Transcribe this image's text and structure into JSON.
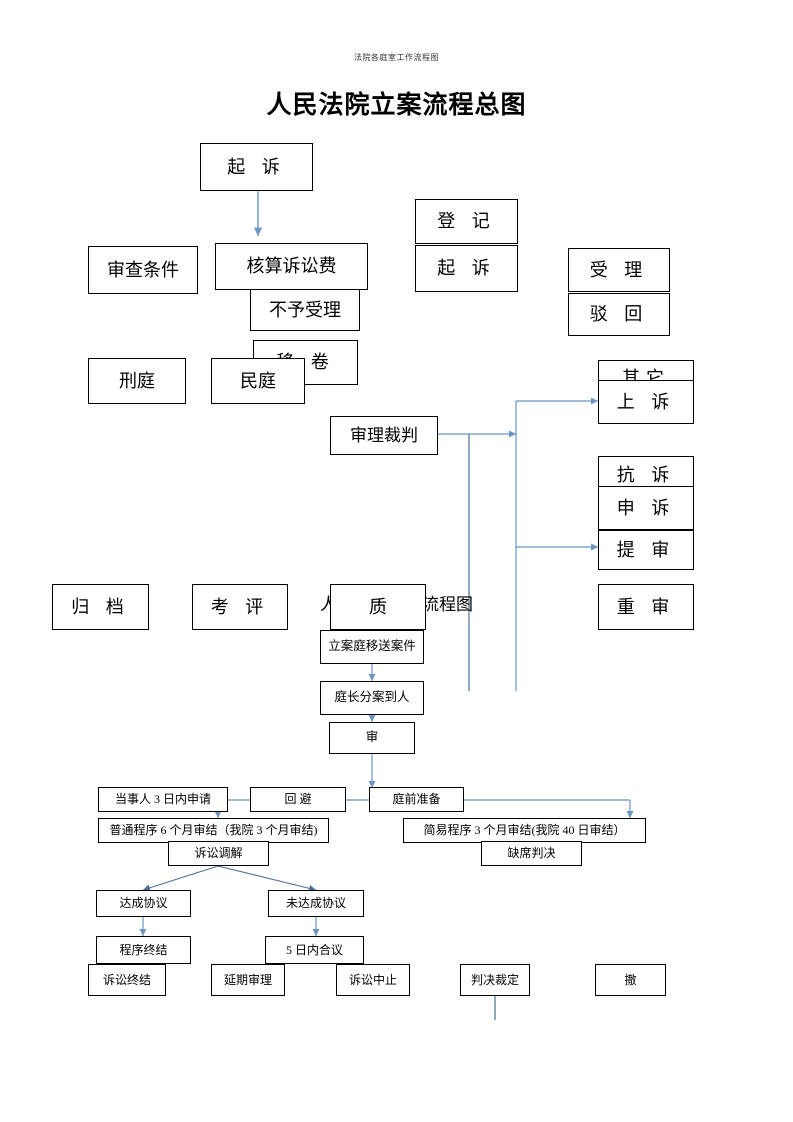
{
  "page": {
    "header_note": "法院各庭室工作流程图",
    "title_main": "人民法院立案流程总图",
    "title_sub": "人民法院审判流程图",
    "accent_arrow_color": "#6b96c4",
    "accent_line_color": "#3f6f96",
    "border_color": "#000000",
    "background": "#ffffff"
  },
  "filing_chart": {
    "name": "人民法院立案流程总图",
    "nodes": [
      {
        "id": "qisu",
        "label": "起  诉"
      },
      {
        "id": "shencha",
        "label": "审查条件"
      },
      {
        "id": "hesuan",
        "label": "核算诉讼费"
      },
      {
        "id": "buyushouli",
        "label": "不予受理"
      },
      {
        "id": "dengji",
        "label": "登  记"
      },
      {
        "id": "qisu2",
        "label": "起  诉"
      },
      {
        "id": "shouli",
        "label": "受  理"
      },
      {
        "id": "bohui",
        "label": "驳  回"
      },
      {
        "id": "xingting",
        "label": "刑庭"
      },
      {
        "id": "minting",
        "label": "民庭"
      },
      {
        "id": "yijuan",
        "label": "移  卷"
      },
      {
        "id": "shenlicaipan",
        "label": "审理裁判"
      },
      {
        "id": "shangsu_top",
        "label": "其它"
      },
      {
        "id": "shangsu",
        "label": "上  诉"
      },
      {
        "id": "kangsu",
        "label": "抗  诉"
      },
      {
        "id": "shensu",
        "label": "申  诉"
      },
      {
        "id": "tishen",
        "label": "提  审"
      },
      {
        "id": "chongshen",
        "label": "重  审"
      },
      {
        "id": "guidang",
        "label": "归  档"
      },
      {
        "id": "kaoping",
        "label": "考  评"
      },
      {
        "id": "zhi",
        "label": "质"
      }
    ]
  },
  "trial_chart": {
    "name": "人民法院审判流程图",
    "nodes": [
      {
        "id": "yisong",
        "label": "立案庭移送案件"
      },
      {
        "id": "fenan",
        "label": "庭长分案到人"
      },
      {
        "id": "shen",
        "label": "审"
      },
      {
        "id": "shenqing",
        "label": "当事人 3 日内申请"
      },
      {
        "id": "huibi",
        "label": "回        避"
      },
      {
        "id": "tingqian",
        "label": "庭前准备"
      },
      {
        "id": "putong",
        "label": "普通程序 6 个月审结（我院 3 个月审结)"
      },
      {
        "id": "jianyi",
        "label": "简易程序 3 个月审结(我院 40 日审结）"
      },
      {
        "id": "tiaojie",
        "label": "诉讼调解"
      },
      {
        "id": "quexi",
        "label": "缺席判决"
      },
      {
        "id": "dacheng",
        "label": "达成协议"
      },
      {
        "id": "weidacheng",
        "label": "未达成协议"
      },
      {
        "id": "chengxu",
        "label": "程序终结"
      },
      {
        "id": "wuri",
        "label": "5 日内合议"
      },
      {
        "id": "susong",
        "label": "诉讼终结"
      },
      {
        "id": "yanqi",
        "label": "延期审理"
      },
      {
        "id": "zhongzhi",
        "label": "诉讼中止"
      },
      {
        "id": "panjue",
        "label": "判决裁定"
      },
      {
        "id": "che",
        "label": "撤"
      }
    ]
  }
}
